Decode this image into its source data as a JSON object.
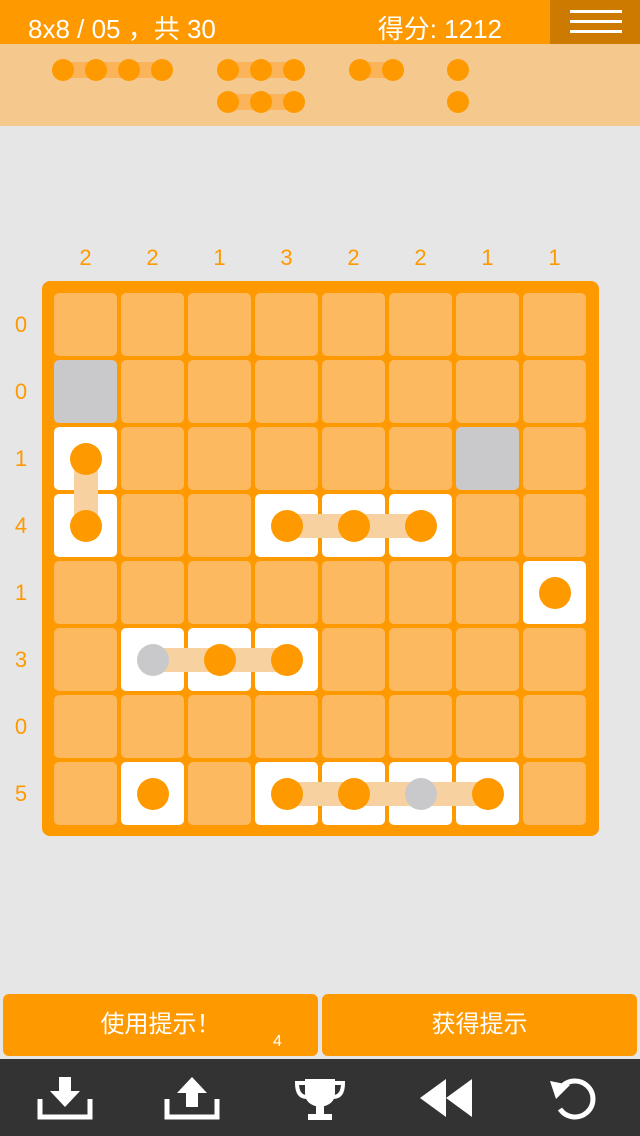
{
  "header": {
    "level": "8x8 / 05 ，共 30",
    "score": "得分: 1212"
  },
  "fleet": [
    {
      "length": 4
    },
    {
      "length": 3
    },
    {
      "length": 2
    },
    {
      "length": 1
    },
    {
      "length": 3
    },
    {
      "length": 1
    }
  ],
  "puzzle": {
    "column_counts": [
      "2",
      "2",
      "1",
      "3",
      "2",
      "2",
      "1",
      "1"
    ],
    "row_counts": [
      "0",
      "0",
      "1",
      "4",
      "1",
      "3",
      "0",
      "5"
    ],
    "grid": [
      "........",
      "W.......",
      "S.....W.",
      "S..SSS..",
      ".......S",
      ".GSS....",
      "........",
      ".S.SSGS."
    ],
    "ship_links": [
      {
        "row": 2,
        "col": 0,
        "dir": "down",
        "span": 1
      },
      {
        "row": 3,
        "col": 3,
        "dir": "right",
        "span": 2
      },
      {
        "row": 5,
        "col": 1,
        "dir": "right",
        "span": 2
      },
      {
        "row": 7,
        "col": 3,
        "dir": "right",
        "span": 3
      }
    ]
  },
  "actions": {
    "use_hint": "使用提示！",
    "hint_count": "4",
    "get_hint": "获得提示"
  },
  "toolbar": [
    "download-icon",
    "upload-icon",
    "trophy-icon",
    "rewind-icon",
    "undo-icon"
  ],
  "colors": {
    "accent": "#ff9900",
    "accent_dark": "#cc7a00",
    "cell": "#fdb95f",
    "water": "#c9c9cc",
    "ship_cell": "#ffffff",
    "background": "#e6e6e6",
    "toolbar": "#333333"
  }
}
